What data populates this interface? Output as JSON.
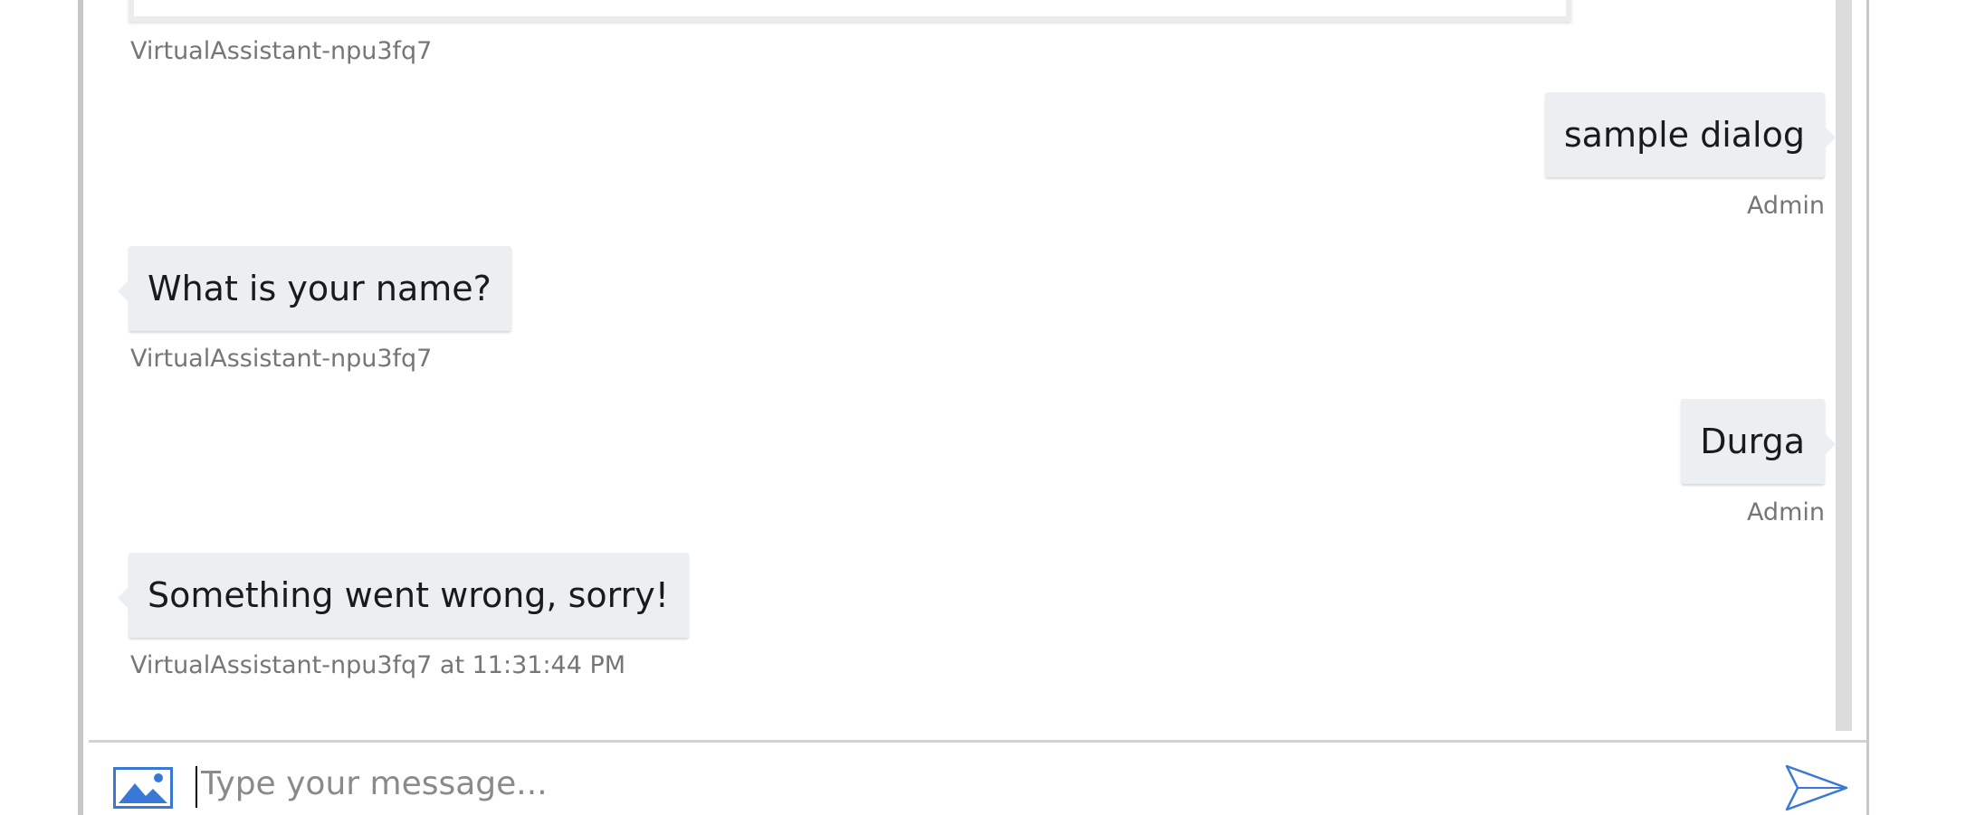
{
  "messages": [
    {
      "from": "bot",
      "text": "",
      "meta": "VirtualAssistant-npu3fq7"
    },
    {
      "from": "user",
      "text": "sample dialog",
      "meta": "Admin"
    },
    {
      "from": "bot",
      "text": "What is your name?",
      "meta": "VirtualAssistant-npu3fq7"
    },
    {
      "from": "user",
      "text": "Durga",
      "meta": "Admin"
    },
    {
      "from": "bot",
      "text": "Something went wrong, sorry!",
      "meta": "VirtualAssistant-npu3fq7 at 11:31:44 PM"
    }
  ],
  "input": {
    "placeholder": "Type your message...",
    "value": ""
  },
  "icons": {
    "upload": "image-icon",
    "send": "send-icon"
  },
  "colors": {
    "bubble": "#eceff1",
    "meta_text": "#767676",
    "icon_blue": "#3a78d6"
  }
}
